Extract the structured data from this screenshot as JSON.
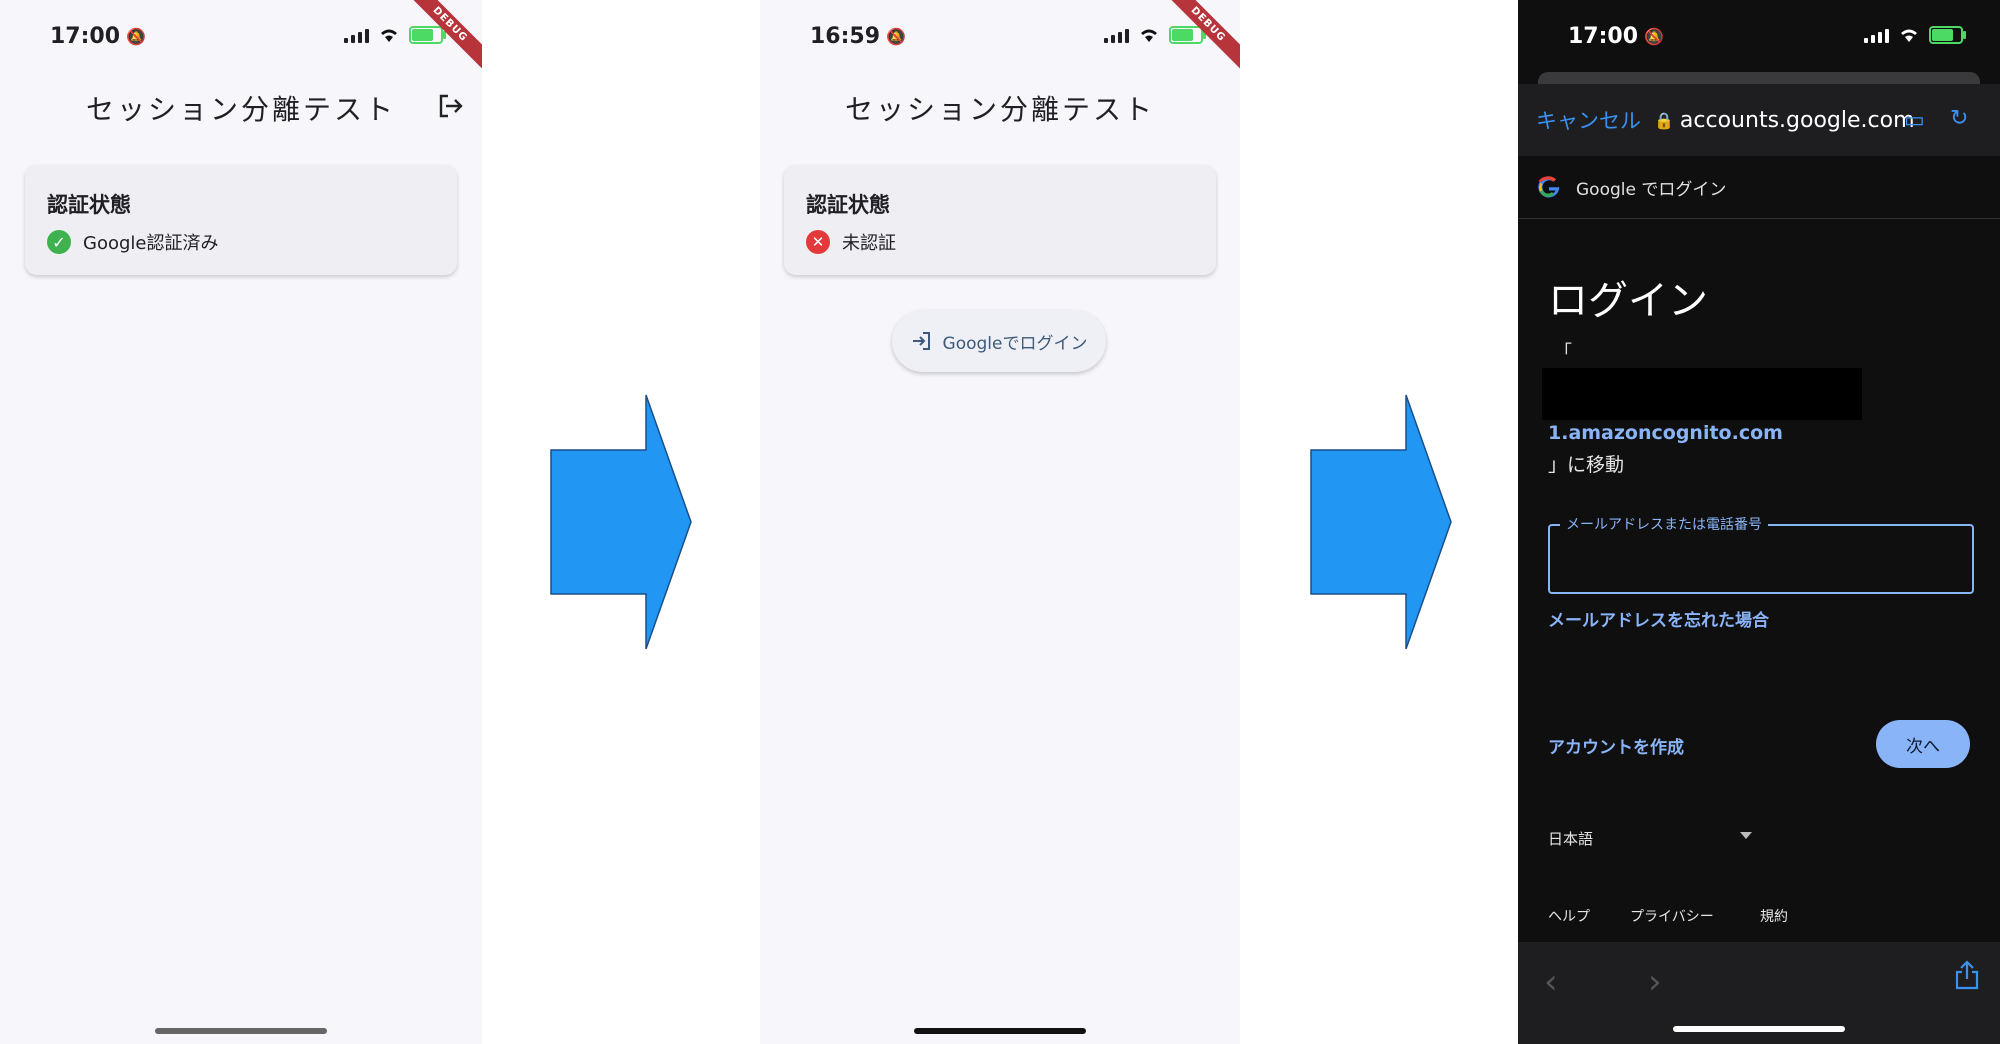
{
  "screens": [
    {
      "status": {
        "time": "17:00"
      },
      "debug_label": "DEBUG",
      "app_title": "セッション分離テスト",
      "card": {
        "title": "認証状態",
        "status": "Google認証済み"
      }
    },
    {
      "status": {
        "time": "16:59"
      },
      "debug_label": "DEBUG",
      "app_title": "セッション分離テスト",
      "card": {
        "title": "認証状態",
        "status": "未認証"
      },
      "login_button": "Googleでログイン"
    },
    {
      "status": {
        "time": "17:00"
      },
      "browser": {
        "cancel": "キャンセル",
        "url": "accounts.google.com"
      },
      "google_bar": "Google でログイン",
      "heading": "ログイン",
      "open_bracket": "「",
      "domain": "1.amazoncognito.com",
      "move_text": "」に移動",
      "email_field": {
        "label": "メールアドレスまたは電話番号",
        "value": ""
      },
      "forgot_email": "メールアドレスを忘れた場合",
      "create_account": "アカウントを作成",
      "next_button": "次へ",
      "language": "日本語",
      "footer": {
        "help": "ヘルプ",
        "privacy": "プライバシー",
        "terms": "規約"
      }
    }
  ],
  "colors": {
    "arrow": "#2196f3",
    "link": "#8ab4f8",
    "ok": "#3fb24f",
    "ng": "#e2393a"
  }
}
